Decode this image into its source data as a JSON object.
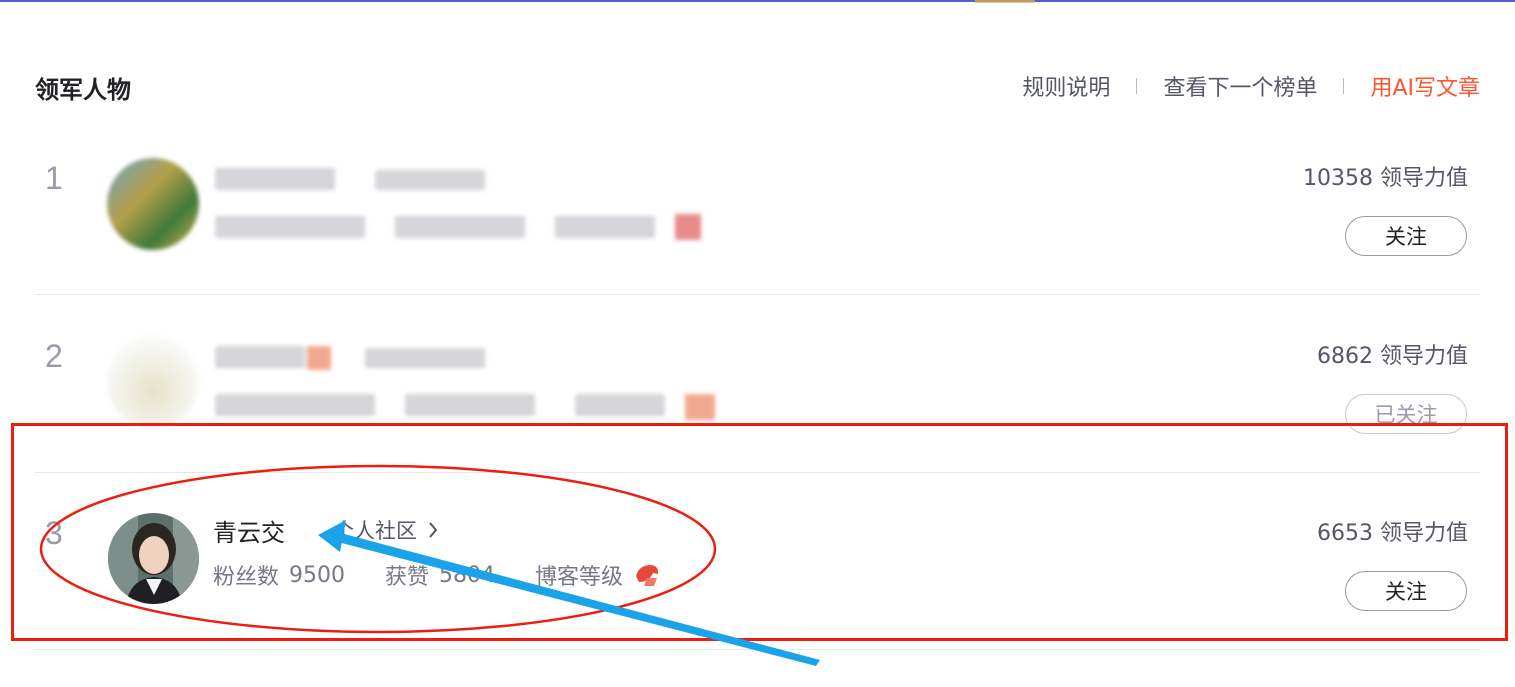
{
  "header": {
    "title": "领军人物",
    "links": {
      "rules": "规则说明",
      "next_list": "查看下一个榜单",
      "ai_write": "用AI写文章"
    }
  },
  "ranking": [
    {
      "rank": "1",
      "score": "10358 领导力值",
      "follow_label": "关注",
      "blurred": true
    },
    {
      "rank": "2",
      "score": "6862 领导力值",
      "follow_label": "已关注",
      "blurred": true
    },
    {
      "rank": "3",
      "name": "青云交",
      "community": "个人社区",
      "fans_label": "粉丝数",
      "fans_value": "9500",
      "likes_label": "获赞",
      "likes_value": "5804",
      "level_label": "博客等级",
      "score": "6653 领导力值",
      "follow_label": "关注",
      "blurred": false
    }
  ],
  "colors": {
    "accent": "#fc5531",
    "annotation_red": "#ee1e0f",
    "annotation_arrow": "#1aa3e8",
    "top_bar": "#5b5bd6"
  },
  "icons": {
    "community_chevron": "chevron-right-icon",
    "blog_level": "blog-level-badge-icon"
  }
}
